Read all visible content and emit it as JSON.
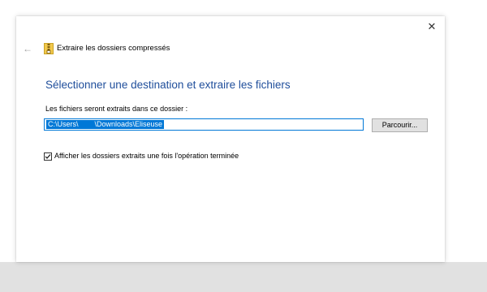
{
  "window": {
    "title": "Extraire les dossiers compressés",
    "close_icon": "close-icon",
    "back_icon": "back-arrow-icon",
    "app_icon": "zip-folder-icon"
  },
  "main": {
    "heading": "Sélectionner une destination et extraire les fichiers",
    "path_label": "Les fichiers seront extraits dans ce dossier :",
    "path_value": "C:\\Users\\        \\Downloads\\Eliseuse",
    "browse_label": "Parcourir...",
    "checkbox_label": "Afficher les dossiers extraits une fois l'opération terminée",
    "checkbox_checked": true
  },
  "colors": {
    "accent": "#0078d7",
    "heading": "#1f4e9b",
    "button_bg": "#e1e1e1"
  }
}
